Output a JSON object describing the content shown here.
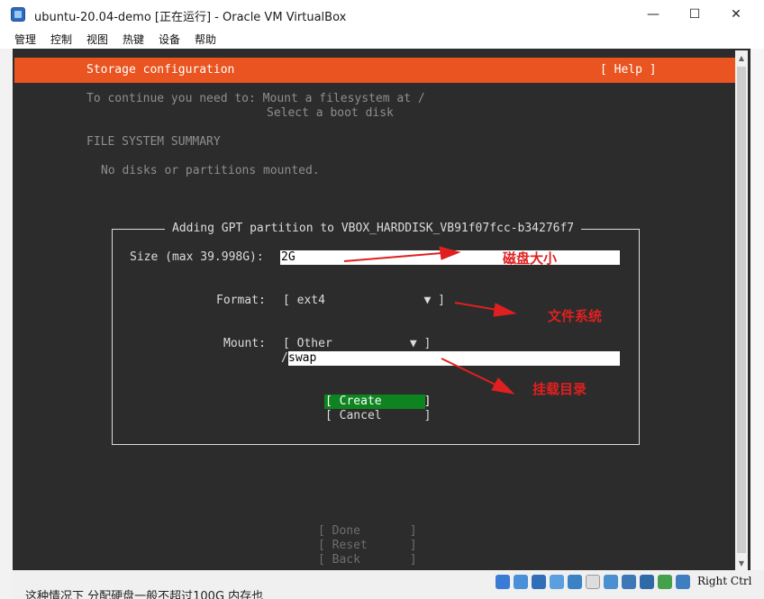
{
  "window": {
    "title": "ubuntu-20.04-demo [正在运行] - Oracle VM VirtualBox",
    "minimize_icon": "—",
    "maximize_icon": "☐",
    "close_icon": "✕"
  },
  "menu": {
    "items": [
      "管理",
      "控制",
      "视图",
      "热键",
      "设备",
      "帮助"
    ]
  },
  "installer": {
    "header_title": "Storage configuration",
    "help_label": "[ Help ]",
    "notice_line1": "To continue you need to: Mount a filesystem at /",
    "notice_line2": "Select a boot disk",
    "summary_heading": "FILE SYSTEM SUMMARY",
    "summary_text": "No disks or partitions mounted.",
    "dialog": {
      "title": "Adding GPT partition to VBOX_HARDDISK_VB91f07fcc-b34276f7",
      "size_label": "Size (max 39.998G):",
      "size_value": "2G",
      "format_label": "Format:",
      "format_value": "[ ext4              ▼ ]",
      "mount_label": "Mount:",
      "mount_value": "[ Other           ▼ ]",
      "mount_path_prefix": "/",
      "mount_path_value": "swap",
      "create_label": "[ Create      ]",
      "cancel_label": "[ Cancel      ]"
    },
    "footer": {
      "done_label": "[ Done       ]",
      "reset_label": "[ Reset      ]",
      "back_label": "[ Back       ]"
    }
  },
  "annotations": {
    "size_note": "磁盘大小",
    "format_note": "文件系统",
    "mount_note": "挂载目录",
    "arrow_color": "#e02020"
  },
  "statusbar": {
    "host_key": "Right Ctrl",
    "background_text": "这种情况下 分配硬盘一般不超过100G 内存也"
  },
  "colors": {
    "ubuntu_orange": "#e95420",
    "create_green": "#0e8420",
    "console_bg": "#2c2c2c"
  }
}
